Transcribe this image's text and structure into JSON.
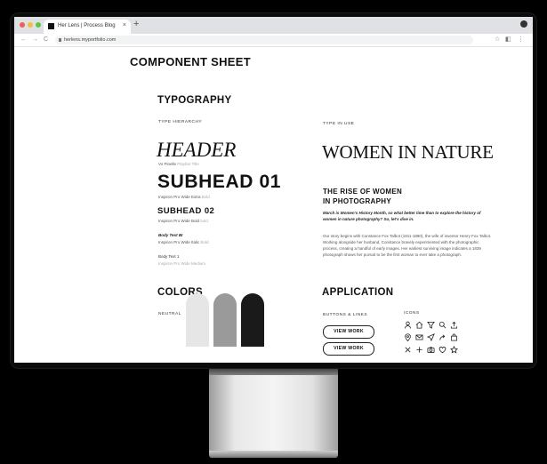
{
  "browser": {
    "tab_title": "Her Lens | Process Blog",
    "tab_close": "×",
    "new_tab": "+",
    "url": "herlens.myportfolio.com",
    "nav_back": "←",
    "nav_forward": "→",
    "nav_reload": "C"
  },
  "page": {
    "title": "COMPONENT SHEET",
    "typography": {
      "heading": "TYPOGRAPHY",
      "hierarchy_label": "TYPE HIERARCHY",
      "header_sample": "HEADER",
      "header_caption_a": "Vs Pinelle",
      "header_caption_b": "Playfair Title",
      "subhead01_sample": "SUBHEAD 01",
      "subhead01_caption_a": "Inspiron Pro Wide Extra",
      "subhead01_caption_b": "Bold",
      "subhead02_sample": "SUBHEAD 02",
      "subhead02_caption_a": "Inspiron Pro Wide Bold",
      "subhead02_caption_b": "bold",
      "bodybi_label": "Body Text BI",
      "bodybi_caption_a": "Inspiron Pro Wide Italic",
      "bodybi_caption_b": "Bold",
      "body_label": "Body Text 1",
      "body_caption": "Inspiron Pro Wide Medium",
      "in_use_label": "TYPE IN USE",
      "in_use_header": "WOMEN IN NATURE",
      "in_use_sub_line1": "THE RISE OF WOMEN",
      "in_use_sub_line2": "IN PHOTOGRAPHY",
      "in_use_italic": "March is Women's History Month, so what better time than to explore the history of women in nature photography? So, let's dive in.",
      "in_use_body": "Our story begins with Constance Fox Talbot (1811-1880), the wife of inventor Henry Fox Talbot. Working alongside her husband, Constance bravely experimented with the photographic process, creating a handful of early images. Her earliest surviving image indicates a 1839 photograph shows her pursuit to be the first woman to ever take a photograph."
    },
    "colors": {
      "heading": "COLORS",
      "neutral_label": "NEUTRAL",
      "swatches": [
        "#e6e6e6",
        "#9a9a9a",
        "#1a1a1a"
      ]
    },
    "application": {
      "heading": "APPLICATION",
      "buttons_label": "BUTTONS & LINKS",
      "button1": "VIEW WORK",
      "button2": "VIEW WORK",
      "icons_label": "ICONS",
      "icons": [
        "user-icon",
        "home-icon",
        "filter-icon",
        "search-icon",
        "upload-icon",
        "location-pin-icon",
        "mail-icon",
        "send-icon",
        "share-icon",
        "bag-icon",
        "close-icon",
        "plus-icon",
        "camera-icon",
        "heart-icon",
        "star-icon"
      ]
    }
  }
}
